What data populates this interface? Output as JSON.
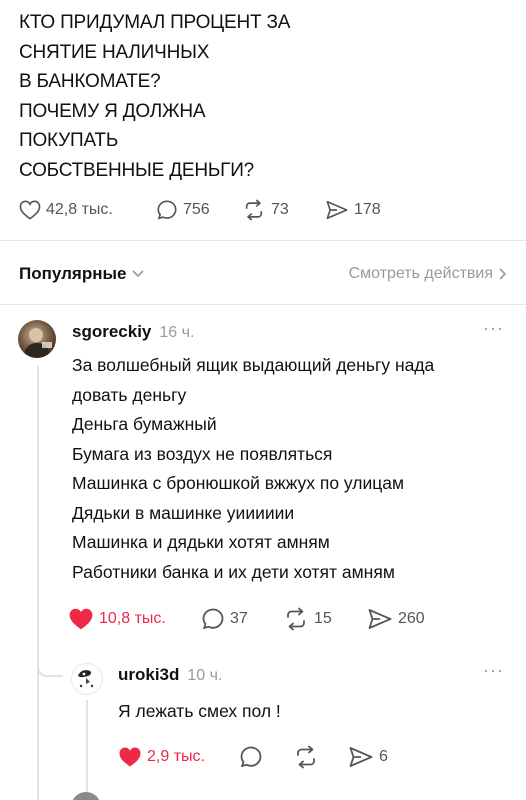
{
  "post": {
    "lines": [
      "КТО ПРИДУМАЛ ПРОЦЕНТ ЗА",
      "СНЯТИЕ НАЛИЧНЫХ",
      "В БАНКОМАТЕ?",
      "ПОЧЕМУ Я ДОЛЖНА",
      "ПОКУПАТЬ",
      "СОБСТВЕННЫЕ ДЕНЬГИ?"
    ],
    "likes": "42,8 тыс.",
    "replies": "756",
    "reposts": "73",
    "shares": "178"
  },
  "sort": {
    "label": "Популярные",
    "view_activity": "Смотреть действия"
  },
  "comments": [
    {
      "username": "sgoreckiy",
      "time": "16 ч.",
      "more": "···",
      "lines": [
        "За волшебный ящик выдающий деньгу нада",
        "довать деньгу",
        "Деньга бумажный",
        "Бумага из воздух не появляться",
        "Машинка с бронюшкой вжжух по улицам",
        "Дядьки в машинке уииииии",
        "Машинка и дядьки хотят амням",
        "Работники банка и их дети хотят амням"
      ],
      "likes": "10,8 тыс.",
      "replies": "37",
      "reposts": "15",
      "shares": "260",
      "liked": true
    },
    {
      "username": "uroki3d",
      "time": "10 ч.",
      "more": "···",
      "text": "Я лежать смех пол !",
      "likes": "2,9 тыс.",
      "shares": "6",
      "liked": true
    }
  ],
  "colors": {
    "like_red": "#ee2845",
    "muted": "#9a9a9a",
    "icon_gray": "#555555"
  },
  "icons": [
    "heart-icon",
    "comment-icon",
    "repost-icon",
    "share-icon",
    "chevron-down-icon",
    "chevron-right-icon",
    "more-icon"
  ]
}
